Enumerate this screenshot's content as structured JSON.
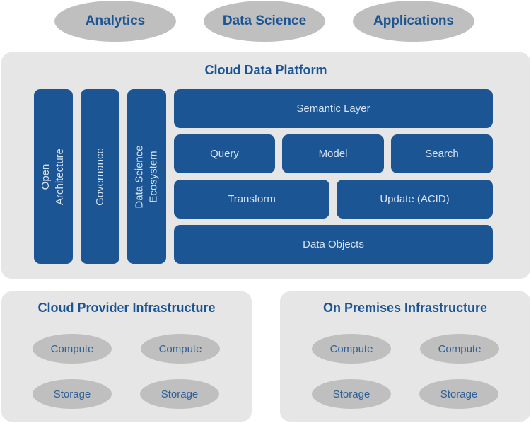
{
  "top_layer": [
    "Analytics",
    "Data Science",
    "Applications"
  ],
  "platform": {
    "title": "Cloud Data Platform",
    "vertical": [
      "Open\nArchitecture",
      "Governance",
      "Data Science\nEcosystem"
    ],
    "semantic": "Semantic Layer",
    "row2": [
      "Query",
      "Model",
      "Search"
    ],
    "row3": [
      "Transform",
      "Update (ACID)"
    ],
    "base": "Data Objects"
  },
  "infrastructure": [
    {
      "title": "Cloud Provider Infrastructure",
      "items": [
        "Compute",
        "Compute",
        "Storage",
        "Storage"
      ]
    },
    {
      "title": "On Premises Infrastructure",
      "items": [
        "Compute",
        "Compute",
        "Storage",
        "Storage"
      ]
    }
  ],
  "colors": {
    "primary": "#1b5593",
    "panel": "#e6e6e6",
    "ellipse": "#bfbfbf"
  }
}
